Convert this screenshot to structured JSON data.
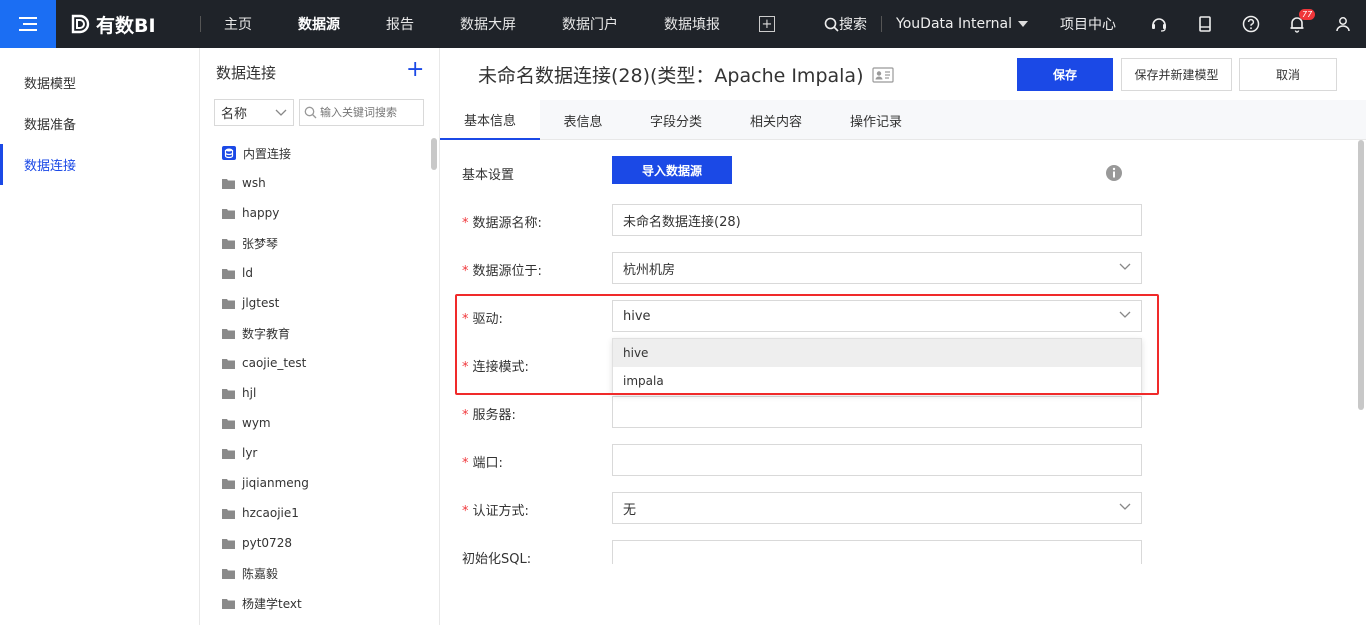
{
  "app": {
    "logo_text": "有数BI",
    "nav": [
      {
        "label": "主页"
      },
      {
        "label": "数据源"
      },
      {
        "label": "报告"
      },
      {
        "label": "数据大屏"
      },
      {
        "label": "数据门户"
      },
      {
        "label": "数据填报"
      }
    ],
    "search_label": "搜索",
    "org_name": "YouData Internal",
    "project_label": "项目中心",
    "notification_count": "77"
  },
  "sidebar": {
    "items": [
      {
        "label": "数据模型"
      },
      {
        "label": "数据准备"
      },
      {
        "label": "数据连接"
      }
    ]
  },
  "connections": {
    "title": "数据连接",
    "filter_value": "名称",
    "search_placeholder": "输入关键词搜索",
    "tree": [
      {
        "label": "内置连接",
        "icon": "database-icon"
      },
      {
        "label": "wsh",
        "icon": "folder-icon"
      },
      {
        "label": "happy",
        "icon": "folder-icon"
      },
      {
        "label": "张梦琴",
        "icon": "folder-icon"
      },
      {
        "label": "ld",
        "icon": "folder-icon"
      },
      {
        "label": "jlgtest",
        "icon": "folder-icon"
      },
      {
        "label": "数字教育",
        "icon": "folder-icon"
      },
      {
        "label": "caojie_test",
        "icon": "folder-icon"
      },
      {
        "label": "hjl",
        "icon": "folder-icon"
      },
      {
        "label": "wym",
        "icon": "folder-icon"
      },
      {
        "label": "lyr",
        "icon": "folder-icon"
      },
      {
        "label": "jiqianmeng",
        "icon": "folder-icon"
      },
      {
        "label": "hzcaojie1",
        "icon": "folder-icon"
      },
      {
        "label": "pyt0728",
        "icon": "folder-icon"
      },
      {
        "label": "陈嘉毅",
        "icon": "folder-icon"
      },
      {
        "label": "杨建学text",
        "icon": "folder-icon"
      }
    ]
  },
  "page": {
    "title": "未命名数据连接(28)(类型：Apache Impala)",
    "save_label": "保存",
    "save_new_label": "保存并新建模型",
    "cancel_label": "取消"
  },
  "tabs": [
    {
      "label": "基本信息"
    },
    {
      "label": "表信息"
    },
    {
      "label": "字段分类"
    },
    {
      "label": "相关内容"
    },
    {
      "label": "操作记录"
    }
  ],
  "form": {
    "section_label": "基本设置",
    "import_label": "导入数据源",
    "name_label": "数据源名称:",
    "name_value": "未命名数据连接(28)",
    "location_label": "数据源位于:",
    "location_value": "杭州机房",
    "driver_label": "驱动:",
    "driver_value": "hive",
    "driver_options": [
      "hive",
      "impala"
    ],
    "mode_label": "连接模式:",
    "server_label": "服务器:",
    "port_label": "端口:",
    "auth_label": "认证方式:",
    "auth_value": "无",
    "init_sql_label": "初始化SQL:"
  },
  "colors": {
    "primary": "#1b49e6",
    "topbar": "#1f2329",
    "highlight": "#f02a2a"
  }
}
